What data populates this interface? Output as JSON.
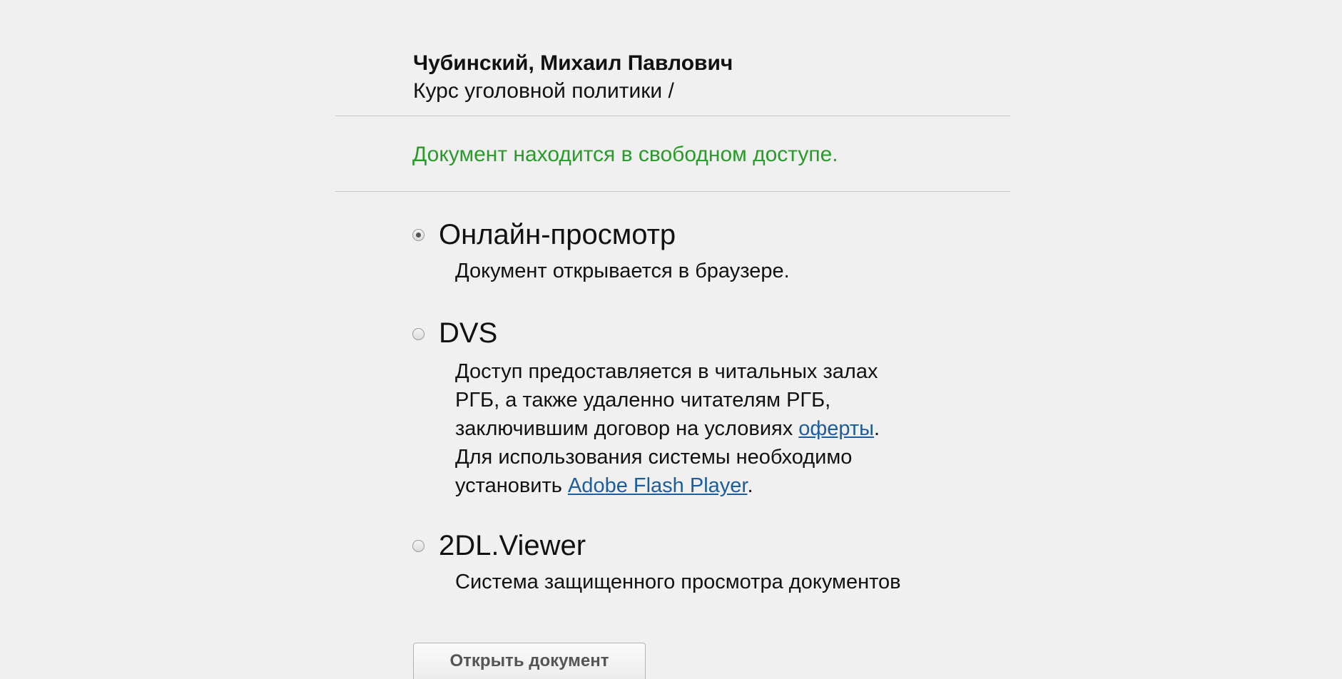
{
  "record": {
    "author": "Чубинский, Михаил Павлович",
    "title": "Курс уголовной политики /"
  },
  "access_note": "Документ находится в свободном доступе.",
  "options": [
    {
      "title": "Онлайн-просмотр",
      "selected": true,
      "description_lines": [
        "Документ открывается в браузере."
      ]
    },
    {
      "title": "DVS",
      "selected": false,
      "description": {
        "line1": "Доступ предоставляется в читальных залах",
        "line2": "РГБ, а также удаленно читателям РГБ,",
        "line3_prefix": "заключившим договор на условиях ",
        "line3_link": "оферты",
        "line3_suffix": ".",
        "line4": "Для использования системы необходимо",
        "line5_prefix": "установить ",
        "line5_link": "Adobe Flash Player",
        "line5_suffix": "."
      }
    },
    {
      "title": "2DL.Viewer",
      "selected": false,
      "description_lines": [
        "Система защищенного просмотра документов"
      ]
    }
  ],
  "open_button_label": "Открыть документ",
  "colors": {
    "background": "#f0f0f0",
    "access_note": "#2a9a2a",
    "link": "#1d5d9b",
    "divider": "#c8c8c8"
  }
}
